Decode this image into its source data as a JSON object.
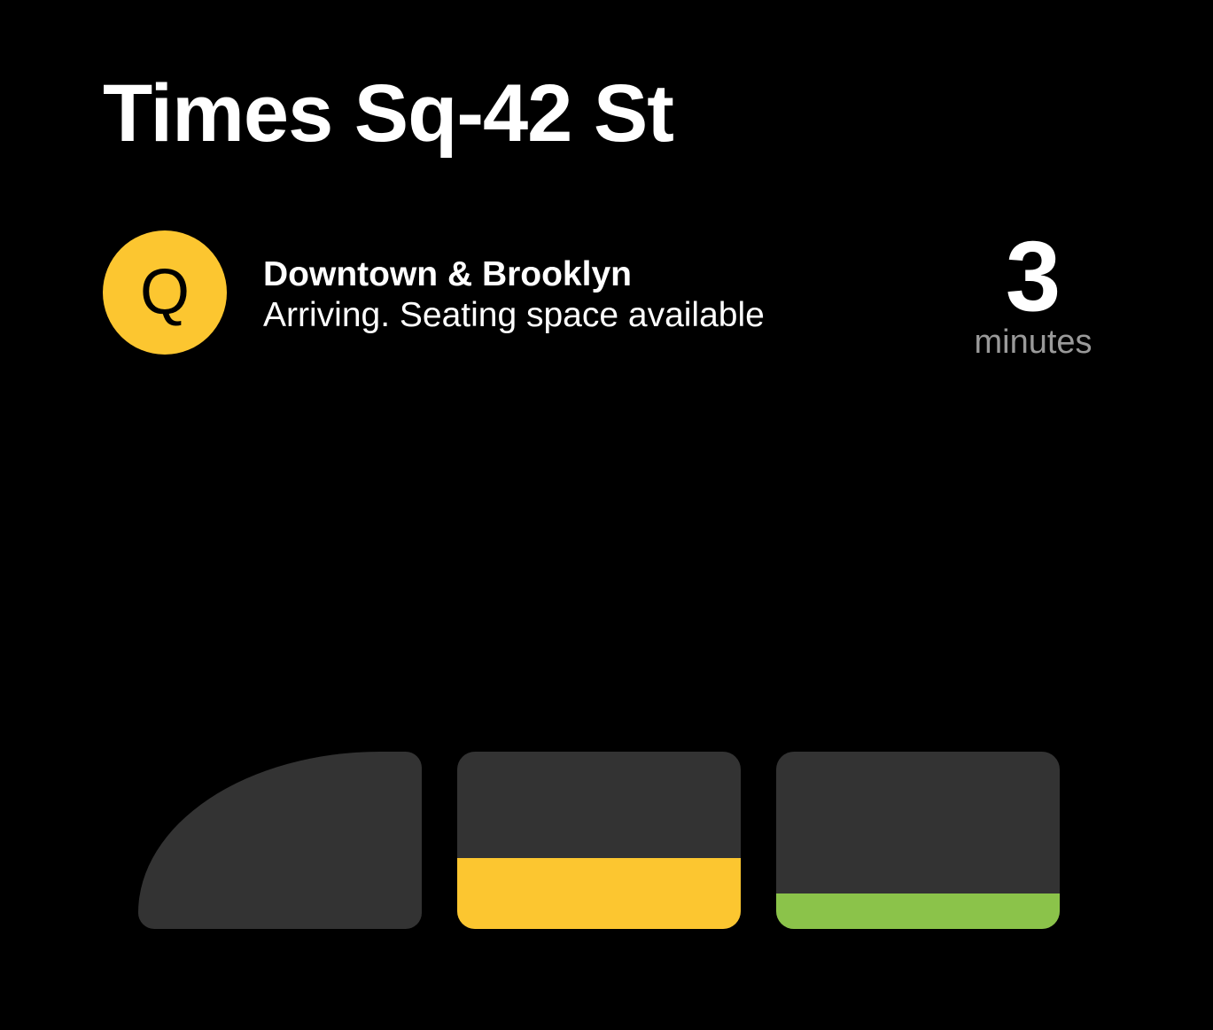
{
  "station": {
    "name": "Times Sq-42 St"
  },
  "arrival": {
    "route": "Q",
    "route_color": "#FCC630",
    "route_text_color": "#000000",
    "destination": "Downtown & Brooklyn",
    "status": "Arriving. Seating space available",
    "eta_value": "3",
    "eta_unit": "minutes"
  },
  "train": {
    "car_color": "#333333",
    "cars": [
      {
        "shape": "lead",
        "crowding_level": 0,
        "fill_color": ""
      },
      {
        "shape": "standard",
        "crowding_level": 0.4,
        "fill_color": "#FCC630"
      },
      {
        "shape": "standard",
        "crowding_level": 0.2,
        "fill_color": "#8BC34A"
      }
    ]
  }
}
